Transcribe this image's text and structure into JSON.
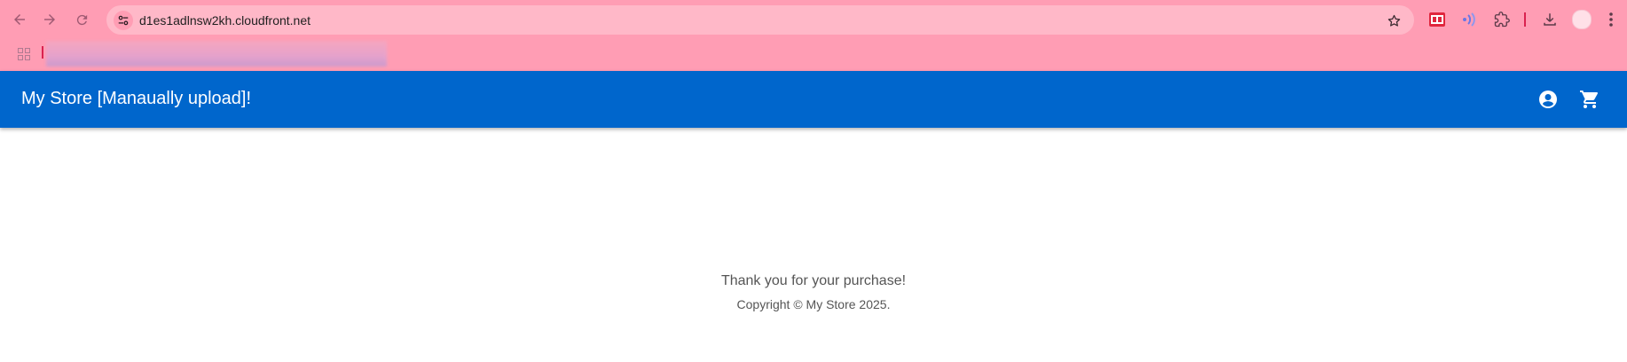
{
  "browser": {
    "url": "d1es1adlnsw2kh.cloudfront.net",
    "icons": {
      "back": "arrow-left-icon",
      "forward": "arrow-right-icon",
      "reload": "reload-icon",
      "site_info": "tune-icon",
      "bookmark": "star-icon",
      "extension_1": "fe-extension-icon",
      "extension_2": "audio-extension-icon",
      "extensions": "puzzle-icon",
      "download": "download-icon",
      "profile": "profile-avatar",
      "menu": "kebab-menu-icon",
      "apps": "apps-grid-icon"
    },
    "colors": {
      "frame": "#ff9db4",
      "omnibox": "#ffb8c8"
    }
  },
  "appbar": {
    "title": "My Store [Manaually upload]!",
    "icons": {
      "account": "account-circle-icon",
      "cart": "shopping-cart-icon"
    },
    "colors": {
      "background": "#0066cc",
      "foreground": "#ffffff"
    }
  },
  "main": {
    "message": "Thank you for your purchase!",
    "copyright": "Copyright © My Store 2025."
  }
}
